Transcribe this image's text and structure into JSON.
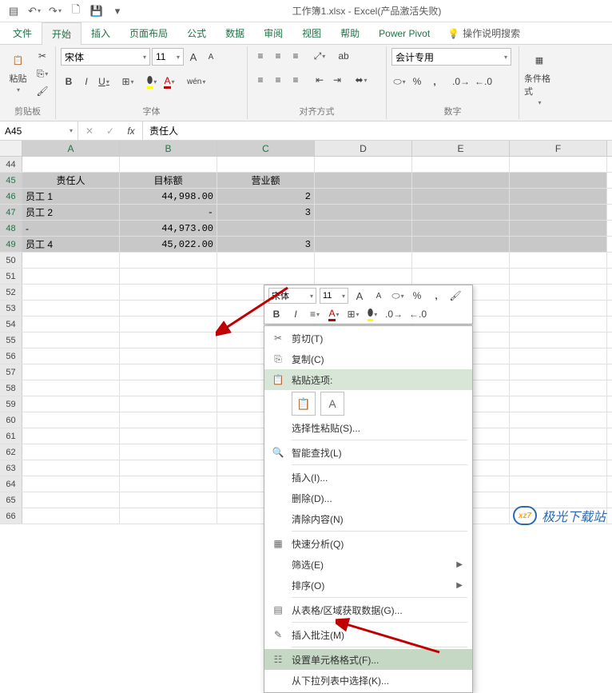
{
  "window": {
    "title": "工作簿1.xlsx - Excel(产品激活失败)"
  },
  "qat": {
    "undo": "↶",
    "redo": "↷"
  },
  "tabs": {
    "items": [
      "文件",
      "开始",
      "插入",
      "页面布局",
      "公式",
      "数据",
      "审阅",
      "视图",
      "帮助",
      "Power Pivot"
    ],
    "active_index": 1,
    "search": "操作说明搜索"
  },
  "ribbon": {
    "clipboard": {
      "label": "剪贴板",
      "paste": "粘贴"
    },
    "font": {
      "label": "字体",
      "name": "宋体",
      "size": "11",
      "increase": "A",
      "decrease": "A",
      "b": "B",
      "i": "I",
      "u": "U"
    },
    "alignment": {
      "label": "对齐方式",
      "wrap": "ab",
      "merge": "⬌"
    },
    "number": {
      "label": "数字",
      "format": "会计专用",
      "currency": "⬭",
      "percent": "%",
      "comma": ","
    },
    "styles": {
      "label": "",
      "condfmt": "条件格式"
    }
  },
  "formula_bar": {
    "namebox": "A45",
    "fx": "fx",
    "value": "责任人"
  },
  "columns": [
    "A",
    "B",
    "C",
    "D",
    "E",
    "F"
  ],
  "rows": [
    {
      "n": "44",
      "cells": [
        "",
        "",
        "",
        "",
        "",
        ""
      ]
    },
    {
      "n": "45",
      "cells": [
        "责任人",
        "目标额",
        "营业额",
        "",
        "",
        ""
      ],
      "selected": true,
      "active": true,
      "head": true
    },
    {
      "n": "46",
      "cells": [
        "员工 1",
        "44,998.00",
        "2",
        "",
        "",
        ""
      ],
      "selected": true
    },
    {
      "n": "47",
      "cells": [
        "员工 2",
        "-",
        "3",
        "",
        "",
        ""
      ],
      "selected": true
    },
    {
      "n": "48",
      "cells": [
        "-",
        "44,973.00",
        "",
        "",
        "",
        ""
      ],
      "selected": true
    },
    {
      "n": "49",
      "cells": [
        "员工 4",
        "45,022.00",
        "3",
        "",
        "",
        ""
      ],
      "selected": true
    },
    {
      "n": "50",
      "cells": [
        "",
        "",
        "",
        "",
        "",
        ""
      ]
    },
    {
      "n": "51",
      "cells": [
        "",
        "",
        "",
        "",
        "",
        ""
      ]
    },
    {
      "n": "52",
      "cells": [
        "",
        "",
        "",
        "",
        "",
        ""
      ]
    },
    {
      "n": "53",
      "cells": [
        "",
        "",
        "",
        "",
        "",
        ""
      ]
    },
    {
      "n": "54",
      "cells": [
        "",
        "",
        "",
        "",
        "",
        ""
      ]
    },
    {
      "n": "55",
      "cells": [
        "",
        "",
        "",
        "",
        "",
        ""
      ]
    },
    {
      "n": "56",
      "cells": [
        "",
        "",
        "",
        "",
        "",
        ""
      ]
    },
    {
      "n": "57",
      "cells": [
        "",
        "",
        "",
        "",
        "",
        ""
      ]
    },
    {
      "n": "58",
      "cells": [
        "",
        "",
        "",
        "",
        "",
        ""
      ]
    },
    {
      "n": "59",
      "cells": [
        "",
        "",
        "",
        "",
        "",
        ""
      ]
    },
    {
      "n": "60",
      "cells": [
        "",
        "",
        "",
        "",
        "",
        ""
      ]
    },
    {
      "n": "61",
      "cells": [
        "",
        "",
        "",
        "",
        "",
        ""
      ]
    },
    {
      "n": "62",
      "cells": [
        "",
        "",
        "",
        "",
        "",
        ""
      ]
    },
    {
      "n": "63",
      "cells": [
        "",
        "",
        "",
        "",
        "",
        ""
      ]
    },
    {
      "n": "64",
      "cells": [
        "",
        "",
        "",
        "",
        "",
        ""
      ]
    },
    {
      "n": "65",
      "cells": [
        "",
        "",
        "",
        "",
        "",
        ""
      ]
    },
    {
      "n": "66",
      "cells": [
        "",
        "",
        "",
        "",
        "",
        ""
      ]
    }
  ],
  "minibar": {
    "font": "宋体",
    "size": "11"
  },
  "context_menu": {
    "cut": "剪切(T)",
    "copy": "复制(C)",
    "paste_options": "粘贴选项:",
    "paste_special": "选择性粘贴(S)...",
    "smart_lookup": "智能查找(L)",
    "insert": "插入(I)...",
    "delete": "删除(D)...",
    "clear": "清除内容(N)",
    "quick_analysis": "快速分析(Q)",
    "filter": "筛选(E)",
    "sort": "排序(O)",
    "table_data": "从表格/区域获取数据(G)...",
    "insert_comment": "插入批注(M)",
    "format_cells": "设置单元格格式(F)...",
    "dropdown_select": "从下拉列表中选择(K)..."
  },
  "watermark": {
    "text": "极光下载站"
  }
}
